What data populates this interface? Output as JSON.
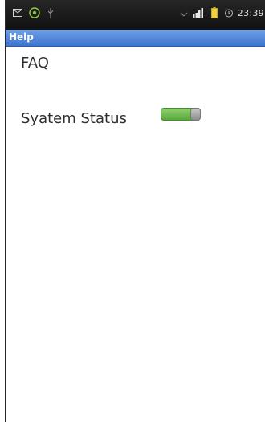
{
  "status_bar": {
    "time": "23:39",
    "icons": [
      "message-icon",
      "android-icon",
      "usb-icon",
      "wifi-icon",
      "signal-icon",
      "battery-icon",
      "alarm-icon"
    ]
  },
  "title_bar": {
    "title": "Help"
  },
  "content": {
    "faq_label": "FAQ",
    "system_status_label": "Syatem Status",
    "system_status_toggle": {
      "state": "on",
      "on_color": "#6cbb4a"
    }
  },
  "colors": {
    "title_bar": "#4a80d8",
    "status_bar": "#1c1c1c",
    "text": "#2e2e2e"
  }
}
